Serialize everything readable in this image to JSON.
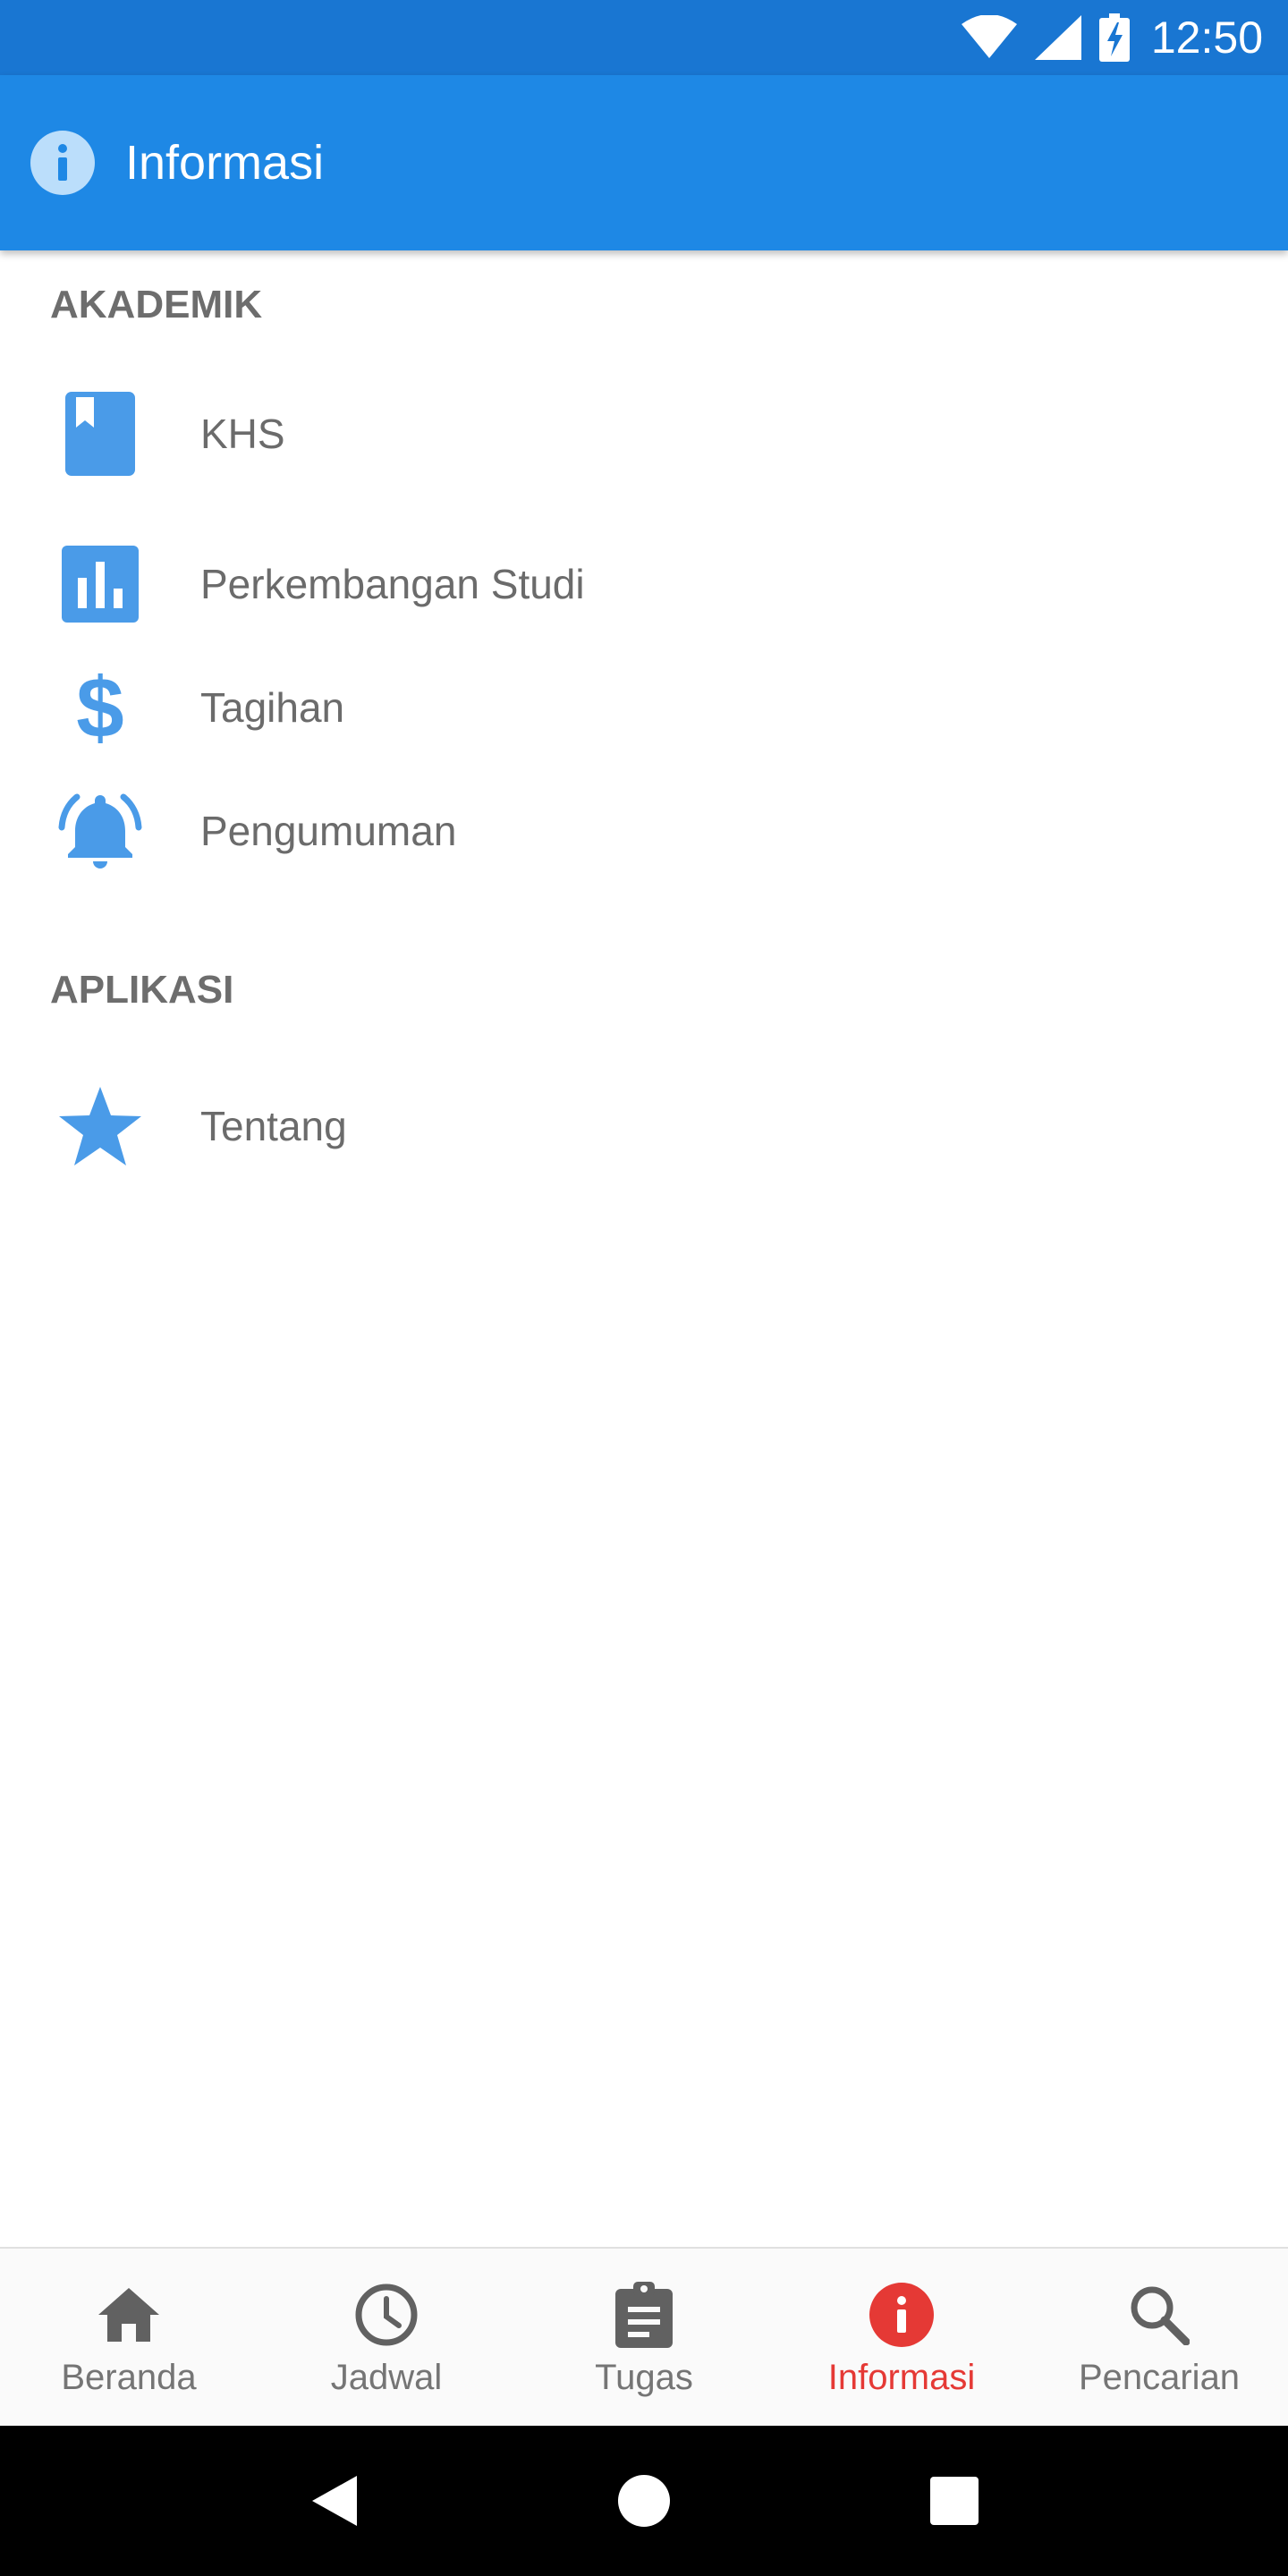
{
  "status_bar": {
    "time": "12:50",
    "icons": [
      "wifi-icon",
      "cellular-signal-icon",
      "battery-charging-icon"
    ]
  },
  "app_bar": {
    "title": "Informasi",
    "icon": "info-icon"
  },
  "sections": [
    {
      "header": "AKADEMIK",
      "items": [
        {
          "label": "KHS",
          "icon": "bookmark-book-icon"
        },
        {
          "label": "Perkembangan Studi",
          "icon": "bar-chart-icon"
        },
        {
          "label": "Tagihan",
          "icon": "dollar-icon"
        },
        {
          "label": "Pengumuman",
          "icon": "notification-bell-icon"
        }
      ]
    },
    {
      "header": "APLIKASI",
      "items": [
        {
          "label": "Tentang",
          "icon": "star-icon"
        }
      ]
    }
  ],
  "bottom_nav": {
    "items": [
      {
        "label": "Beranda",
        "icon": "home-icon"
      },
      {
        "label": "Jadwal",
        "icon": "clock-icon"
      },
      {
        "label": "Tugas",
        "icon": "clipboard-icon"
      },
      {
        "label": "Informasi",
        "icon": "info-icon",
        "active": true
      },
      {
        "label": "Pencarian",
        "icon": "search-icon"
      }
    ]
  },
  "colors": {
    "status_bar": "#1976d2",
    "app_bar": "#1e88e5",
    "menu_icon": "#4a9be8",
    "active_nav": "#e53935",
    "inactive_nav": "#757575"
  }
}
